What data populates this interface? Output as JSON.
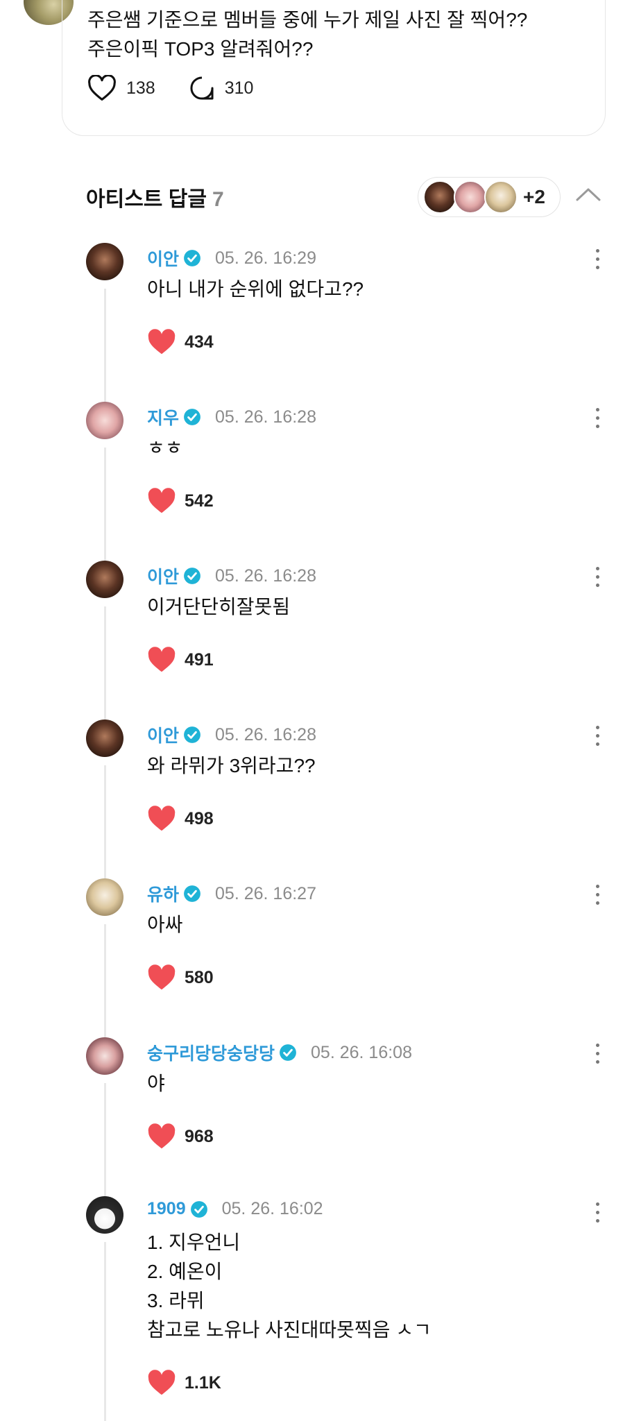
{
  "post": {
    "text": "주은쌤 기준으로 멤버들 중에 누가 제일 사진 잘 찍어??\n주은이픽 TOP3 알려줘어??",
    "likes": "138",
    "comments": "310"
  },
  "artist_replies": {
    "title": "아티스트 답글",
    "count": "7",
    "more_artists": "+2"
  },
  "replies": [
    {
      "name": "이안",
      "time": "05. 26. 16:29",
      "text": "아니 내가 순위에 없다고??",
      "likes": "434"
    },
    {
      "name": "지우",
      "time": "05. 26. 16:28",
      "text": "ㅎㅎ",
      "likes": "542"
    },
    {
      "name": "이안",
      "time": "05. 26. 16:28",
      "text": "이거단단히잘못됨",
      "likes": "491"
    },
    {
      "name": "이안",
      "time": "05. 26. 16:28",
      "text": "와 라뮈가 3위라고??",
      "likes": "498"
    },
    {
      "name": "유하",
      "time": "05. 26. 16:27",
      "text": "아싸",
      "likes": "580"
    },
    {
      "name": "숭구리당당숭당당",
      "time": "05. 26. 16:08",
      "text": "야",
      "likes": "968"
    },
    {
      "name": "1909",
      "time": "05. 26. 16:02",
      "text": "1. 지우언니\n2. 예온이\n3. 라뮈\n참고로 노유나 사진대따못찍음 ㅅㄱ",
      "likes": "1.1K"
    }
  ],
  "colors": {
    "accent_name": "#2f9ad8",
    "heart": "#f04e55",
    "verified": "#1fb3d6"
  },
  "icons": [
    "heart-outline-icon",
    "comment-bubble-icon",
    "chevron-up-icon",
    "verified-badge-icon",
    "heart-filled-icon",
    "more-vertical-icon"
  ]
}
